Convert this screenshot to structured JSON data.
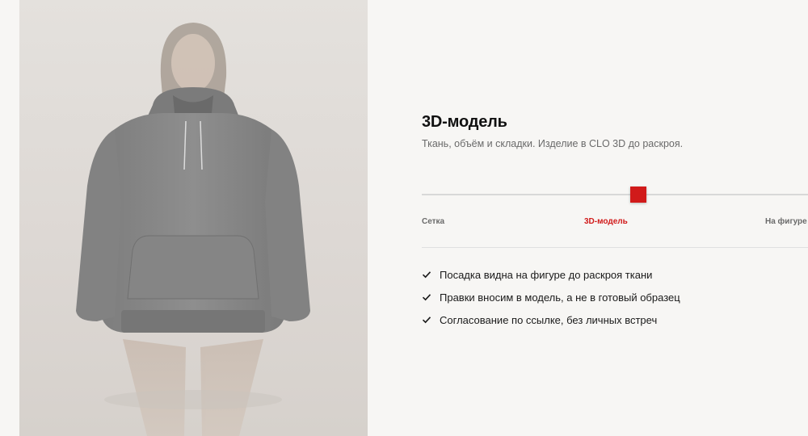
{
  "hero": {
    "image_alt": "Модель в сером худи оверсайз",
    "image_icon": "fashion-model-image"
  },
  "section": {
    "title": "3D-модель",
    "subtitle": "Ткань, объём и складки. Изделие в CLO 3D до раскроя."
  },
  "slider": {
    "steps": [
      "Сетка",
      "3D-модель",
      "На фигуре"
    ],
    "active_index": 1,
    "position_fraction": 0.56,
    "accent_color": "#d11a1a"
  },
  "features": [
    {
      "text": "Посадка видна на фигуре до раскроя ткани",
      "icon": "check-icon"
    },
    {
      "text": "Правки вносим в модель, а не в готовый образец",
      "icon": "check-icon"
    },
    {
      "text": "Согласование по ссылке, без личных встреч",
      "icon": "check-icon"
    }
  ]
}
